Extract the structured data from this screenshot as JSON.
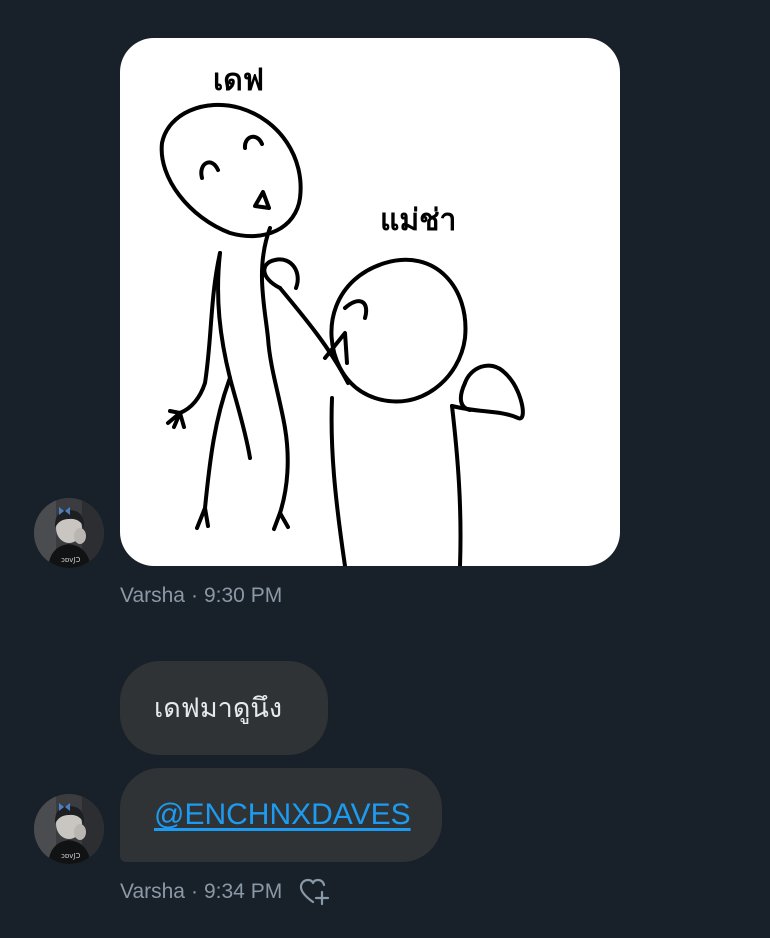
{
  "messages": [
    {
      "type": "image",
      "sender": "Varsha",
      "time": "9:30 PM",
      "meme": {
        "top_caption": "เดฟ",
        "right_caption": "แม่ช่า"
      }
    },
    {
      "type": "text",
      "text": "เดฟมาดูนึง"
    },
    {
      "type": "text",
      "mention": "@ENCHNXDAVES",
      "sender": "Varsha",
      "time": "9:34 PM"
    }
  ],
  "separator": "·",
  "icons": {
    "avatar": "user-avatar",
    "reaction": "add-reaction-heart-icon"
  },
  "colors": {
    "background": "#18202a",
    "bubble": "#2f3336",
    "link": "#1d9bf0",
    "meta_text": "#8b98a5"
  }
}
